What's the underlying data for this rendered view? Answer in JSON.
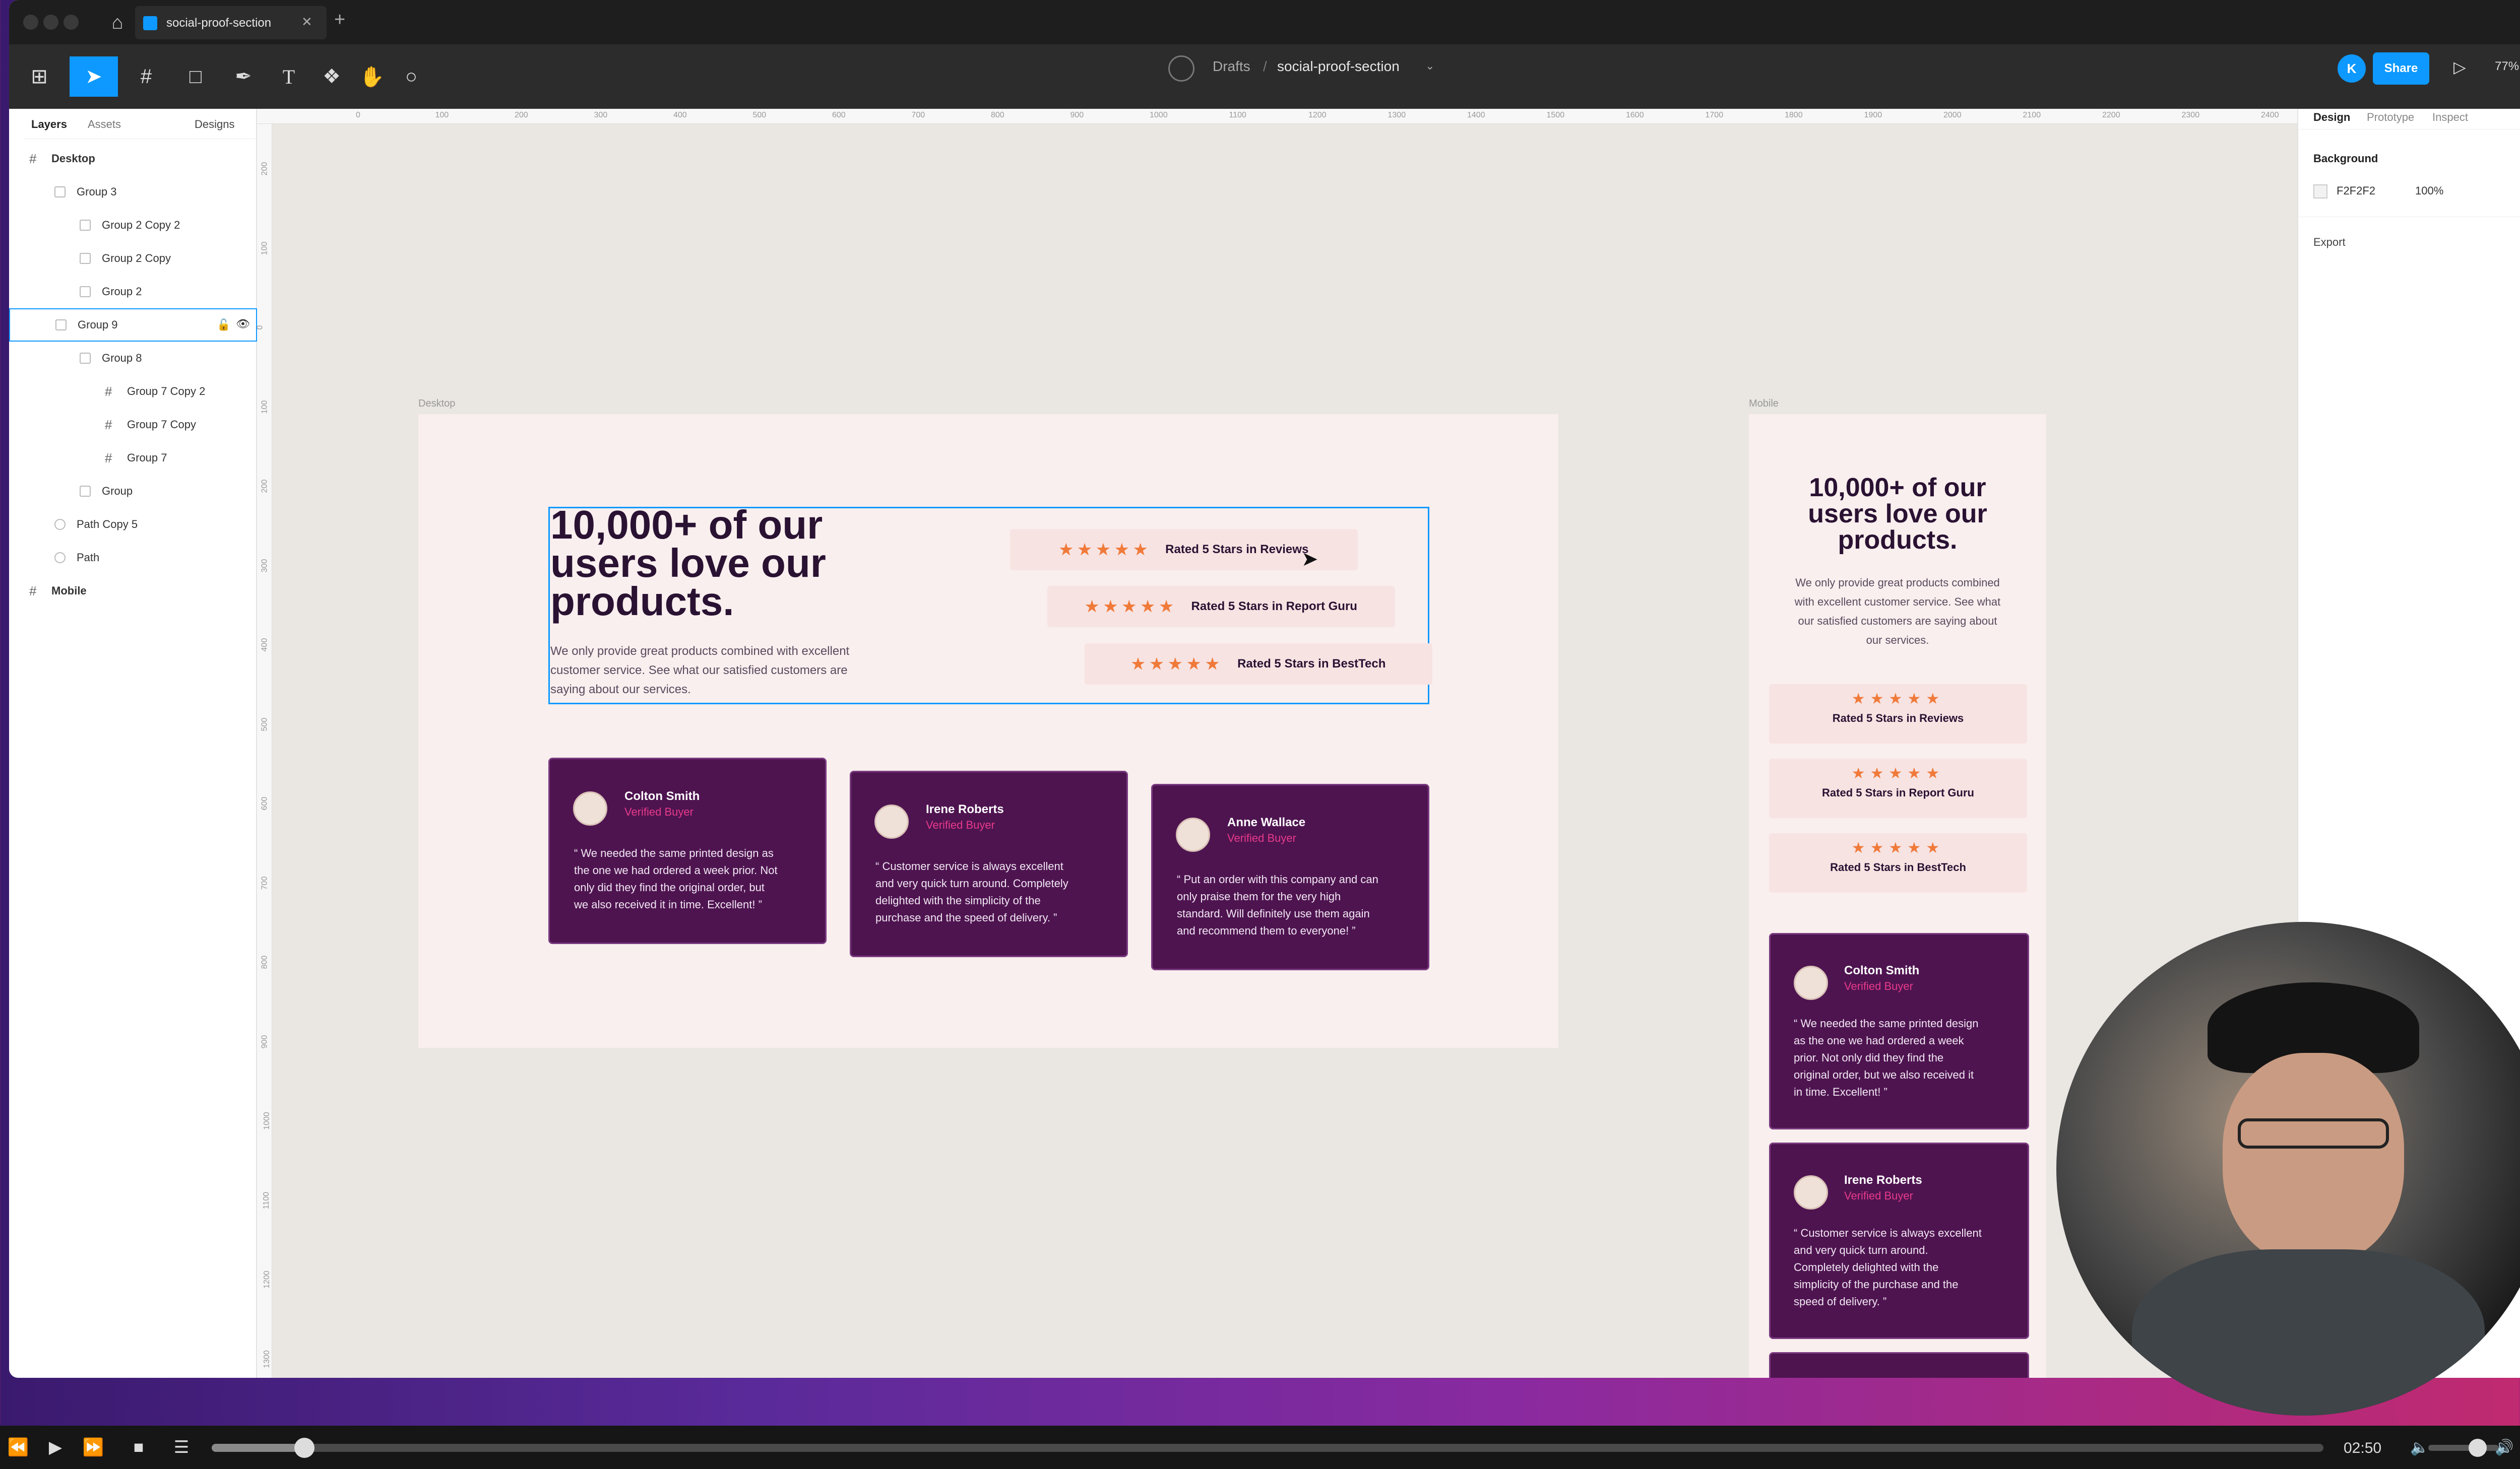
{
  "window": {
    "tab_title": "social-proof-section",
    "breadcrumb_root": "Drafts",
    "breadcrumb_sep": "/",
    "file_name": "social-proof-section",
    "share_label": "Share",
    "avatar_initial": "K",
    "zoom": "77%"
  },
  "left_panel": {
    "tabs": [
      "Layers",
      "Assets"
    ],
    "page_selector": "Designs",
    "layers": [
      {
        "label": "Desktop",
        "level": 0,
        "kind": "frame"
      },
      {
        "label": "Group 3",
        "level": 1,
        "kind": "group"
      },
      {
        "label": "Group 2 Copy 2",
        "level": 2,
        "kind": "group"
      },
      {
        "label": "Group 2 Copy",
        "level": 2,
        "kind": "group"
      },
      {
        "label": "Group 2",
        "level": 2,
        "kind": "group"
      },
      {
        "label": "Group 9",
        "level": 1,
        "kind": "group",
        "selected": true
      },
      {
        "label": "Group 8",
        "level": 2,
        "kind": "group"
      },
      {
        "label": "Group 7 Copy 2",
        "level": 3,
        "kind": "frame"
      },
      {
        "label": "Group 7 Copy",
        "level": 3,
        "kind": "frame"
      },
      {
        "label": "Group 7",
        "level": 3,
        "kind": "frame"
      },
      {
        "label": "Group",
        "level": 2,
        "kind": "group"
      },
      {
        "label": "Path Copy 5",
        "level": 1,
        "kind": "path"
      },
      {
        "label": "Path",
        "level": 1,
        "kind": "path"
      },
      {
        "label": "Mobile",
        "level": 0,
        "kind": "frame"
      }
    ]
  },
  "right_panel": {
    "tabs": [
      "Design",
      "Prototype",
      "Inspect"
    ],
    "background_label": "Background",
    "background_hex": "F2F2F2",
    "background_opacity": "100%",
    "export_label": "Export"
  },
  "rulers": {
    "horizontal": [
      "0",
      "100",
      "200",
      "300",
      "400",
      "500",
      "600",
      "700",
      "800",
      "900",
      "1000",
      "1100",
      "1200",
      "1300",
      "1400",
      "1500",
      "1600",
      "1700",
      "1800",
      "1900",
      "2000",
      "2100",
      "2200",
      "2300",
      "2400"
    ],
    "vertical": [
      "200",
      "100",
      "0",
      "100",
      "200",
      "300",
      "400",
      "500",
      "600",
      "700",
      "800",
      "900",
      "1000",
      "1100",
      "1200",
      "1300"
    ]
  },
  "desktop_frame": {
    "label": "Desktop",
    "heading_lines": [
      "10,000+ of our",
      "users love our",
      "products."
    ],
    "body_lines": [
      "We only provide great products combined with excellent",
      "customer service. See what our satisfied customers are",
      "saying about our services."
    ],
    "ratings": [
      "Rated 5 Stars in Reviews",
      "Rated 5 Stars in Report Guru",
      "Rated 5 Stars in BestTech"
    ],
    "stars": "★★★★★",
    "testimonials": [
      {
        "name": "Colton Smith",
        "role": "Verified Buyer",
        "quote_lines": [
          "“ We needed the same printed design as",
          "the one we had ordered a week prior. Not",
          "only did they find the original order, but",
          "we also received it in time. Excellent! ”"
        ]
      },
      {
        "name": "Irene Roberts",
        "role": "Verified Buyer",
        "quote_lines": [
          "“ Customer service is always excellent",
          "and very quick turn around. Completely",
          "delighted with the simplicity of the",
          "purchase and the speed of delivery. ”"
        ]
      },
      {
        "name": "Anne Wallace",
        "role": "Verified Buyer",
        "quote_lines": [
          "“ Put an order with this company and can",
          "only praise them for the very high",
          "standard. Will definitely use them again",
          "and recommend them to everyone! ”"
        ]
      }
    ]
  },
  "mobile_frame": {
    "label": "Mobile",
    "heading_lines": [
      "10,000+ of our",
      "users love our",
      "products."
    ],
    "body_lines": [
      "We only provide great products combined",
      "with excellent customer service. See what",
      "our satisfied customers are saying about",
      "our services."
    ],
    "ratings": [
      "Rated 5 Stars in Reviews",
      "Rated 5 Stars in Report Guru",
      "Rated 5 Stars in BestTech"
    ],
    "testimonials": [
      {
        "name": "Colton Smith",
        "role": "Verified Buyer",
        "quote_lines": [
          "“ We needed the same printed design",
          "as the one we had ordered a week",
          "prior. Not only did they find the",
          "original order, but we also received it",
          "in time. Excellent! ”"
        ]
      },
      {
        "name": "Irene Roberts",
        "role": "Verified Buyer",
        "quote_lines": [
          "“ Customer service is always excellent",
          "and very quick turn around.",
          "Completely delighted with the",
          "simplicity of the purchase and the",
          "speed of delivery. ”"
        ]
      }
    ]
  },
  "player": {
    "time": "02:50",
    "progress": 0.044
  },
  "colors": {
    "accent": "#0d99ff",
    "card_bg": "#4e1450",
    "star": "#f07a3a",
    "verified": "#e83a8a",
    "heading": "#2a1233"
  }
}
